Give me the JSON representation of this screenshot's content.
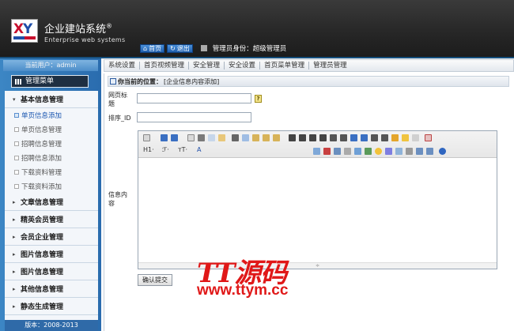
{
  "header": {
    "title": "企业建站系统",
    "registered": "®",
    "subtitle": "Enterprise web systems",
    "home_label": "首页",
    "logout_label": "退出",
    "role_text": "管理员身份：超级管理员"
  },
  "sidebar": {
    "current_user": "当前用户：admin",
    "menu_title": "管理菜单",
    "groups": [
      {
        "label": "基本信息管理",
        "expanded": true,
        "items": [
          "单页信息添加",
          "单页信息管理",
          "招聘信息管理",
          "招聘信息添加",
          "下载资料管理",
          "下载资料添加"
        ]
      },
      {
        "label": "文章信息管理"
      },
      {
        "label": "精英会员管理"
      },
      {
        "label": "会员企业管理"
      },
      {
        "label": "图片信息管理"
      },
      {
        "label": "图片信息管理"
      },
      {
        "label": "其他信息管理"
      },
      {
        "label": "静态生成管理"
      }
    ],
    "version": "版本：2008-2013"
  },
  "topnav": [
    "系统设置",
    "首页视频管理",
    "安全管理",
    "安全设置",
    "首页菜单管理",
    "管理员管理"
  ],
  "content": {
    "crumb_label": "你当前的位置：",
    "crumb_path": "[企业信息内容添加]",
    "field_title_label": "网页标题",
    "field_sort_label": "排序_ID",
    "help_icon": "?",
    "field_content_label": "信息内容",
    "toolbar_h1": "H1·",
    "toolbar_font": "ℱ·",
    "toolbar_size": "тT·",
    "toolbar_color": "A",
    "resize_glyph": "≑",
    "submit_label": "确认提交"
  },
  "watermark": {
    "logo": "TT源码",
    "url": "www.ttym.cc"
  }
}
